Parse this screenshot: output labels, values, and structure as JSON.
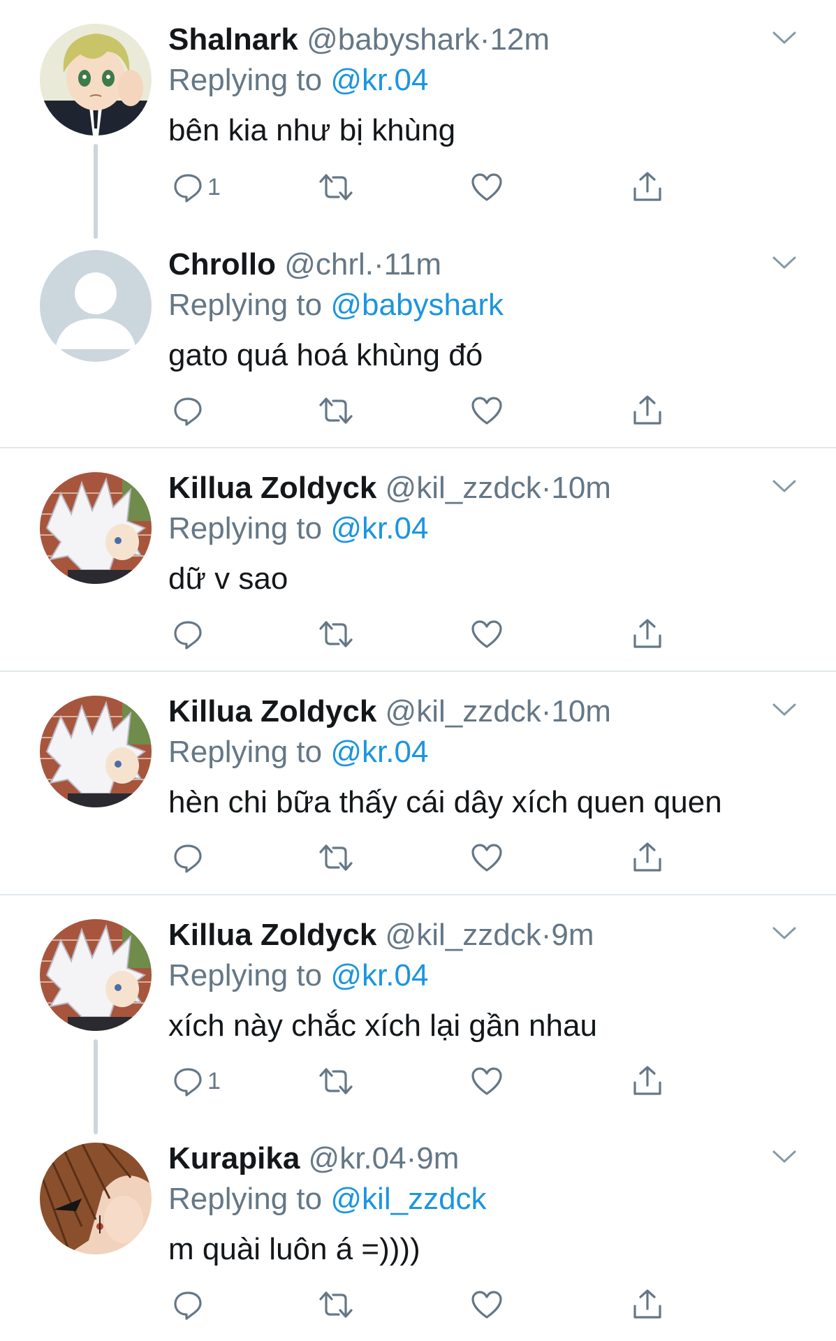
{
  "colors": {
    "text": "#14171a",
    "secondary": "#657786",
    "mention": "#1b95e0",
    "divider": "#e1e8ed",
    "thread_line": "#ccd6dd"
  },
  "tweets": [
    {
      "name": "Shalnark",
      "handle": "@babyshark",
      "separator": "·",
      "time": "12m",
      "replying_prefix": "Replying to",
      "replying_to": "@kr.04",
      "text": "bên kia như bị khùng",
      "reply_count": "1",
      "avatar": "blonde-anime-boy-avatar"
    },
    {
      "name": "Chrollo",
      "handle": "@chrl.",
      "separator": "·",
      "time": "11m",
      "replying_prefix": "Replying to",
      "replying_to": "@babyshark",
      "text": "gato quá hoá khùng đó",
      "reply_count": "",
      "avatar": "default-user-avatar"
    },
    {
      "name": "Killua Zoldyck",
      "handle": "@kil_zzdck",
      "separator": "·",
      "time": "10m",
      "replying_prefix": "Replying to",
      "replying_to": "@kr.04",
      "text": "dữ v sao",
      "reply_count": "",
      "avatar": "white-hair-anime-avatar"
    },
    {
      "name": "Killua Zoldyck",
      "handle": "@kil_zzdck",
      "separator": "·",
      "time": "10m",
      "replying_prefix": "Replying to",
      "replying_to": "@kr.04",
      "text": "hèn chi bữa thấy cái dây xích quen quen",
      "reply_count": "",
      "avatar": "white-hair-anime-avatar"
    },
    {
      "name": "Killua Zoldyck",
      "handle": "@kil_zzdck",
      "separator": "·",
      "time": "9m",
      "replying_prefix": "Replying to",
      "replying_to": "@kr.04",
      "text": "xích này chắc xích lại gần nhau",
      "reply_count": "1",
      "avatar": "white-hair-anime-avatar"
    },
    {
      "name": "Kurapika",
      "handle": "@kr.04",
      "separator": "·",
      "time": "9m",
      "replying_prefix": "Replying to",
      "replying_to": "@kil_zzdck",
      "text": "m quài luôn á =))))",
      "reply_count": "",
      "avatar": "brown-hair-anime-avatar"
    }
  ]
}
